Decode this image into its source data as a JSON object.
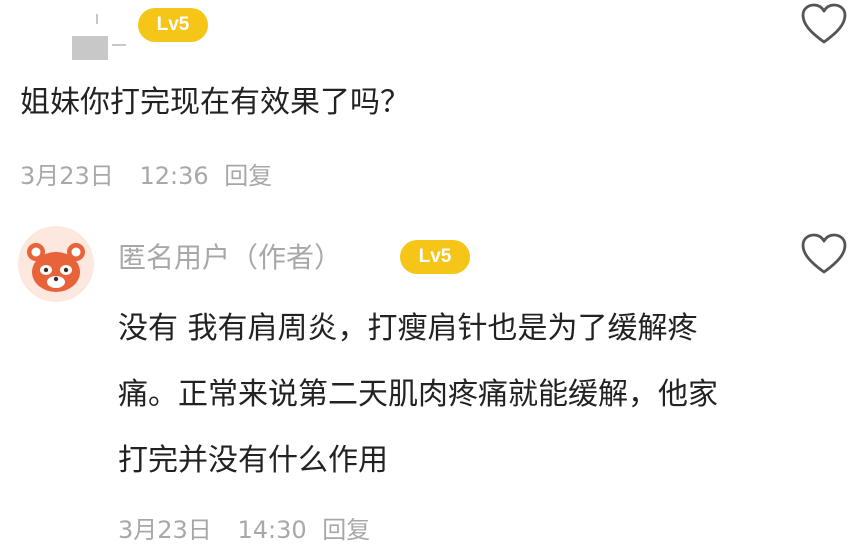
{
  "comment1": {
    "level_badge": "Lv5",
    "text": "姐妹你打完现在有效果了吗？",
    "date": "3月23日",
    "time": "12:36",
    "reply_label": "回复"
  },
  "comment2": {
    "username": "匿名用户（作者）",
    "level_badge": "Lv5",
    "lines": [
      "没有 我有肩周炎，打瘦肩针也是为了缓解疼",
      "痛。正常来说第二天肌肉疼痛就能缓解，他家",
      "打完并没有什么作用"
    ],
    "date": "3月23日",
    "time": "14:30",
    "reply_label": "回复"
  },
  "colors": {
    "badge": "#f5c518",
    "meta_text": "#a8a8a8",
    "body_text": "#222222",
    "avatar_orange": "#e8623a"
  },
  "icons": {
    "like": "heart-outline-icon",
    "avatar": "red-panda-avatar-icon"
  }
}
